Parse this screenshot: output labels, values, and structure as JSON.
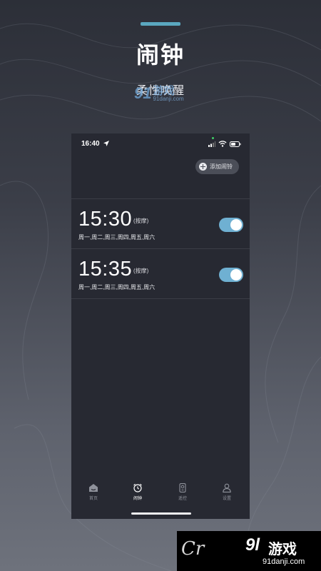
{
  "promo": {
    "title": "闹钟",
    "subtitle": "柔性唤醒",
    "accent_color": "#5aa7bf"
  },
  "watermark_top": {
    "number": "91",
    "brand": "游戏",
    "url": "91danji.com"
  },
  "watermark_bottom": {
    "cr_text": "Cr",
    "number": "9l",
    "brand": "游戏",
    "url": "91danji.com"
  },
  "status_bar": {
    "time": "16:40",
    "icons": [
      "location-arrow-icon",
      "signal-icon",
      "wifi-icon",
      "battery-icon"
    ]
  },
  "header": {
    "add_button_label": "添加闹铃",
    "add_icon": "plus-circle-icon"
  },
  "alarms": [
    {
      "time": "15:30",
      "label": "(按摩)",
      "days": "周一,周二,周三,周四,周五,周六",
      "enabled": true
    },
    {
      "time": "15:35",
      "label": "(按摩)",
      "days": "周一,周二,周三,周四,周五,周六",
      "enabled": true
    }
  ],
  "tabs": [
    {
      "label": "首页",
      "icon": "home-icon",
      "active": false
    },
    {
      "label": "闹钟",
      "icon": "alarm-clock-icon",
      "active": true
    },
    {
      "label": "遥控",
      "icon": "remote-icon",
      "active": false
    },
    {
      "label": "设置",
      "icon": "user-icon",
      "active": false
    }
  ],
  "colors": {
    "toggle_on": "#6fb0d2",
    "phone_bg": "#272932",
    "tab_active": "#ffffff",
    "tab_inactive": "#8f929b"
  }
}
